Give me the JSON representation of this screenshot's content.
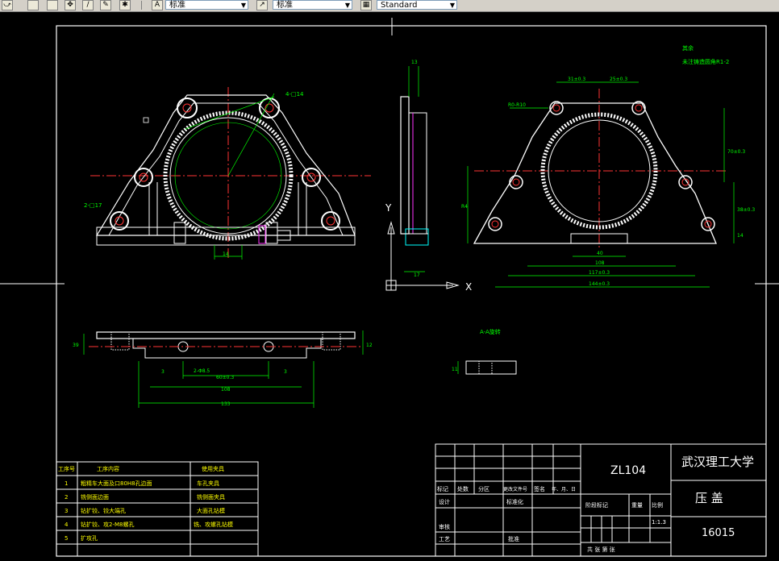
{
  "toolbar": {
    "text_style": "标准",
    "dim_style": "标准",
    "table_style": "Standard"
  },
  "drawing": {
    "ucs": {
      "y": "Y",
      "x": "X"
    },
    "dims_front": [
      "4-□14",
      "2-□17",
      "14"
    ],
    "dims_side": [
      "13",
      "17"
    ],
    "dims_right": [
      "31±0.3",
      "25±0.3",
      "R0-R10",
      "R4",
      "40",
      "108",
      "117±0.3",
      "144±0.3",
      "70±0.3",
      "38±0.3",
      "14"
    ],
    "dims_top": [
      "3",
      "2-Φ8.5",
      "60±0.3",
      "3",
      "108",
      "133",
      "39",
      "12"
    ],
    "section_label": "A-A旋转",
    "section_dim": "11",
    "note": "其余",
    "note2": "未注铸造圆角R1-2"
  },
  "process_table": {
    "headers": [
      "工序号",
      "工序内容",
      "使用夹具"
    ],
    "rows": [
      {
        "no": "1",
        "content": "粗精车大面及口80H8孔边面",
        "fixture": "车孔夹具"
      },
      {
        "no": "2",
        "content": "铣侧面边面",
        "fixture": "铣侧面夹具"
      },
      {
        "no": "3",
        "content": "钻扩铰、铰大端孔",
        "fixture": "大面孔钻模"
      },
      {
        "no": "4",
        "content": "钻扩铰、攻2-M8螺孔",
        "fixture": "铣、攻螺孔钻模"
      },
      {
        "no": "5",
        "content": "扩攻孔",
        "fixture": ""
      }
    ]
  },
  "title_block": {
    "material": "ZL104",
    "school": "武汉理工大学",
    "part_name": "压  盖",
    "drawing_no": "16015",
    "scale": "1:1.3",
    "row_labels": [
      "标记",
      "处数",
      "分区",
      "更改文件号",
      "签名",
      "年、月、日"
    ],
    "design": "设计",
    "standardize": "标准化",
    "stage_mark": "阶段标记",
    "weight": "重量",
    "scale_label": "比例",
    "review": "审核",
    "process": "工艺",
    "approve": "批准",
    "total_sheets": "共    张  第    张"
  }
}
